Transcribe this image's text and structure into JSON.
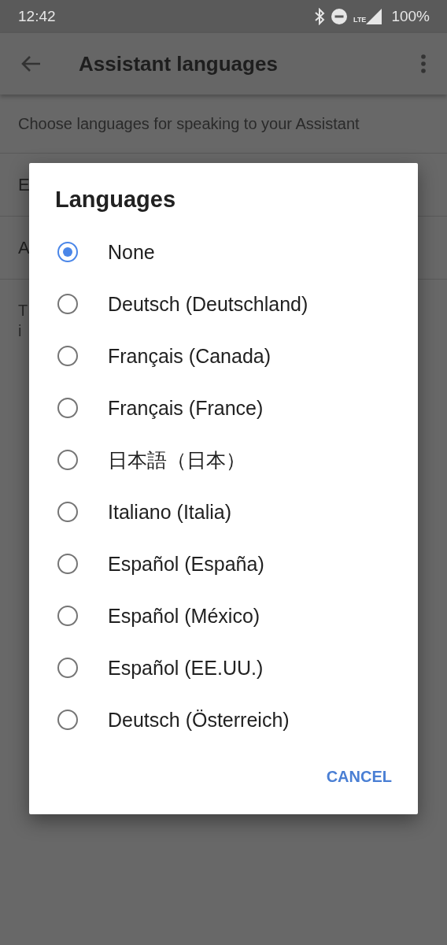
{
  "status_bar": {
    "time": "12:42",
    "network": "LTE",
    "battery": "100%"
  },
  "toolbar": {
    "title": "Assistant languages"
  },
  "description": "Choose languages for speaking to your Assistant",
  "background_rows": [
    "E",
    "A"
  ],
  "background_note": [
    "T",
    "i"
  ],
  "dialog": {
    "title": "Languages",
    "options": [
      {
        "label": "None",
        "selected": true
      },
      {
        "label": "Deutsch (Deutschland)",
        "selected": false
      },
      {
        "label": "Français (Canada)",
        "selected": false
      },
      {
        "label": "Français (France)",
        "selected": false
      },
      {
        "label": "日本語（日本）",
        "selected": false
      },
      {
        "label": "Italiano (Italia)",
        "selected": false
      },
      {
        "label": "Español (España)",
        "selected": false
      },
      {
        "label": "Español (México)",
        "selected": false
      },
      {
        "label": "Español (EE.UU.)",
        "selected": false
      },
      {
        "label": "Deutsch (Österreich)",
        "selected": false
      }
    ],
    "cancel": "CANCEL"
  }
}
